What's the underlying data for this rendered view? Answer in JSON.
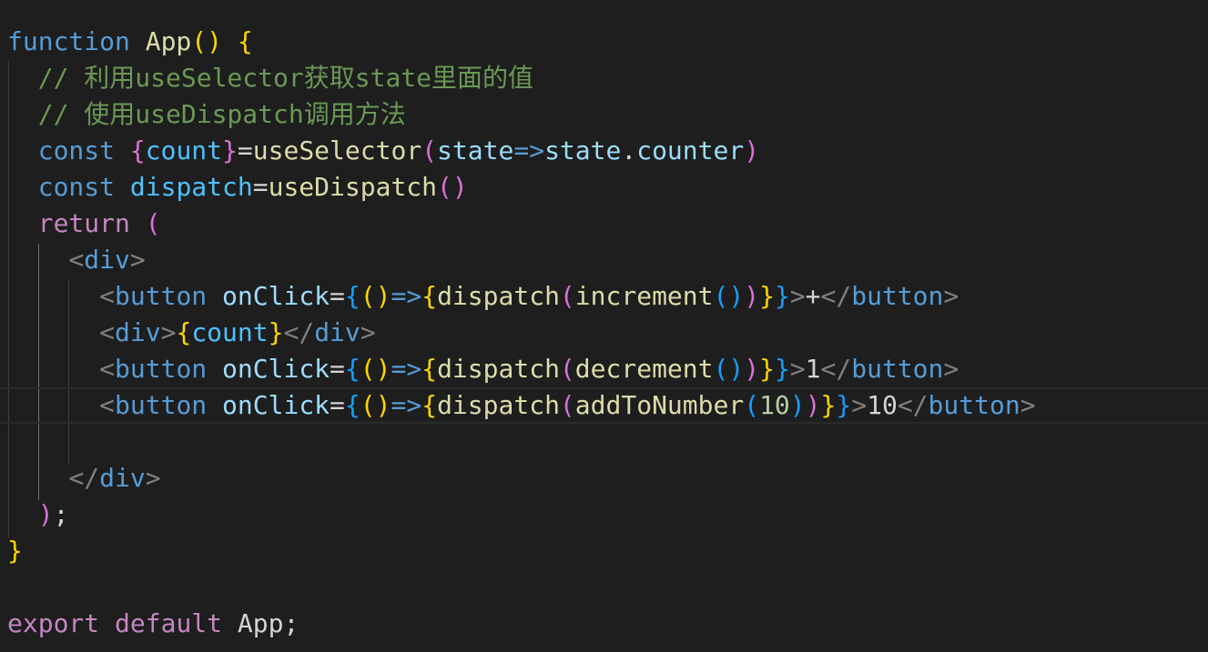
{
  "editor": {
    "language": "javascript-react",
    "theme": "dark",
    "background": "#1e1e1e",
    "colors": {
      "keyword": "#569cd6",
      "control": "#c586c0",
      "function": "#dcdcaa",
      "variable": "#9cdcfe",
      "constant": "#4fc1ff",
      "comment": "#6a9955",
      "number": "#b5cea8",
      "tag_bracket": "#808080",
      "bracket_gold": "#ffd700",
      "bracket_orchid": "#da70d6",
      "bracket_blue": "#179fff",
      "text": "#d4d4d4"
    },
    "lines": [
      [
        [
          "function",
          "keyword"
        ],
        [
          " ",
          "text"
        ],
        [
          "App",
          "function"
        ],
        [
          "(",
          "bracket_gold"
        ],
        [
          ")",
          "bracket_gold"
        ],
        [
          " ",
          "text"
        ],
        [
          "{",
          "bracket_gold"
        ]
      ],
      [
        [
          "  ",
          "text"
        ],
        [
          "// 利用useSelector获取state里面的值",
          "comment"
        ]
      ],
      [
        [
          "  ",
          "text"
        ],
        [
          "// 使用useDispatch调用方法",
          "comment"
        ]
      ],
      [
        [
          "  ",
          "text"
        ],
        [
          "const",
          "keyword"
        ],
        [
          " ",
          "text"
        ],
        [
          "{",
          "bracket_orchid"
        ],
        [
          "count",
          "constant"
        ],
        [
          "}",
          "bracket_orchid"
        ],
        [
          "=",
          "text"
        ],
        [
          "useSelector",
          "function"
        ],
        [
          "(",
          "bracket_orchid"
        ],
        [
          "state",
          "variable"
        ],
        [
          "=>",
          "keyword"
        ],
        [
          "state",
          "variable"
        ],
        [
          ".",
          "text"
        ],
        [
          "counter",
          "variable"
        ],
        [
          ")",
          "bracket_orchid"
        ]
      ],
      [
        [
          "  ",
          "text"
        ],
        [
          "const",
          "keyword"
        ],
        [
          " ",
          "text"
        ],
        [
          "dispatch",
          "constant"
        ],
        [
          "=",
          "text"
        ],
        [
          "useDispatch",
          "function"
        ],
        [
          "()",
          "bracket_orchid"
        ]
      ],
      [
        [
          "  ",
          "text"
        ],
        [
          "return",
          "control"
        ],
        [
          " ",
          "text"
        ],
        [
          "(",
          "bracket_orchid"
        ]
      ],
      [
        [
          "    ",
          "text"
        ],
        [
          "<",
          "tag_bracket"
        ],
        [
          "div",
          "keyword"
        ],
        [
          ">",
          "tag_bracket"
        ]
      ],
      [
        [
          "      ",
          "text"
        ],
        [
          "<",
          "tag_bracket"
        ],
        [
          "button",
          "keyword"
        ],
        [
          " ",
          "text"
        ],
        [
          "onClick",
          "variable"
        ],
        [
          "=",
          "text"
        ],
        [
          "{",
          "bracket_blue"
        ],
        [
          "()",
          "bracket_gold"
        ],
        [
          "=>",
          "keyword"
        ],
        [
          "{",
          "bracket_gold"
        ],
        [
          "dispatch",
          "function"
        ],
        [
          "(",
          "bracket_orchid"
        ],
        [
          "increment",
          "function"
        ],
        [
          "()",
          "bracket_blue"
        ],
        [
          ")",
          "bracket_orchid"
        ],
        [
          "}",
          "bracket_gold"
        ],
        [
          "}",
          "bracket_blue"
        ],
        [
          ">",
          "tag_bracket"
        ],
        [
          "+",
          "text"
        ],
        [
          "</",
          "tag_bracket"
        ],
        [
          "button",
          "keyword"
        ],
        [
          ">",
          "tag_bracket"
        ]
      ],
      [
        [
          "      ",
          "text"
        ],
        [
          "<",
          "tag_bracket"
        ],
        [
          "div",
          "keyword"
        ],
        [
          ">",
          "tag_bracket"
        ],
        [
          "{",
          "bracket_gold"
        ],
        [
          "count",
          "constant"
        ],
        [
          "}",
          "bracket_gold"
        ],
        [
          "</",
          "tag_bracket"
        ],
        [
          "div",
          "keyword"
        ],
        [
          ">",
          "tag_bracket"
        ]
      ],
      [
        [
          "      ",
          "text"
        ],
        [
          "<",
          "tag_bracket"
        ],
        [
          "button",
          "keyword"
        ],
        [
          " ",
          "text"
        ],
        [
          "onClick",
          "variable"
        ],
        [
          "=",
          "text"
        ],
        [
          "{",
          "bracket_blue"
        ],
        [
          "()",
          "bracket_gold"
        ],
        [
          "=>",
          "keyword"
        ],
        [
          "{",
          "bracket_gold"
        ],
        [
          "dispatch",
          "function"
        ],
        [
          "(",
          "bracket_orchid"
        ],
        [
          "decrement",
          "function"
        ],
        [
          "()",
          "bracket_blue"
        ],
        [
          ")",
          "bracket_orchid"
        ],
        [
          "}",
          "bracket_gold"
        ],
        [
          "}",
          "bracket_blue"
        ],
        [
          ">",
          "tag_bracket"
        ],
        [
          "1",
          "text"
        ],
        [
          "</",
          "tag_bracket"
        ],
        [
          "button",
          "keyword"
        ],
        [
          ">",
          "tag_bracket"
        ]
      ],
      [
        [
          "      ",
          "text"
        ],
        [
          "<",
          "tag_bracket"
        ],
        [
          "button",
          "keyword"
        ],
        [
          " ",
          "text"
        ],
        [
          "onClick",
          "variable"
        ],
        [
          "=",
          "text"
        ],
        [
          "{",
          "bracket_blue"
        ],
        [
          "()",
          "bracket_gold"
        ],
        [
          "=>",
          "keyword"
        ],
        [
          "{",
          "bracket_gold"
        ],
        [
          "dispatch",
          "function"
        ],
        [
          "(",
          "bracket_orchid"
        ],
        [
          "addToNumber",
          "function"
        ],
        [
          "(",
          "bracket_blue"
        ],
        [
          "10",
          "number"
        ],
        [
          ")",
          "bracket_blue"
        ],
        [
          ")",
          "bracket_orchid"
        ],
        [
          "}",
          "bracket_gold"
        ],
        [
          "}",
          "bracket_blue"
        ],
        [
          ">",
          "tag_bracket"
        ],
        [
          "10",
          "text"
        ],
        [
          "</",
          "tag_bracket"
        ],
        [
          "button",
          "keyword"
        ],
        [
          ">",
          "tag_bracket"
        ]
      ],
      [],
      [
        [
          "    ",
          "text"
        ],
        [
          "</",
          "tag_bracket"
        ],
        [
          "div",
          "keyword"
        ],
        [
          ">",
          "tag_bracket"
        ]
      ],
      [
        [
          "  ",
          "text"
        ],
        [
          ")",
          "bracket_orchid"
        ],
        [
          ";",
          "text"
        ]
      ],
      [
        [
          "}",
          "bracket_gold"
        ]
      ],
      [],
      [
        [
          "export",
          "control"
        ],
        [
          " ",
          "text"
        ],
        [
          "default",
          "control"
        ],
        [
          " ",
          "text"
        ],
        [
          "App",
          "text"
        ],
        [
          ";",
          "text"
        ]
      ]
    ],
    "current_line": 10
  }
}
